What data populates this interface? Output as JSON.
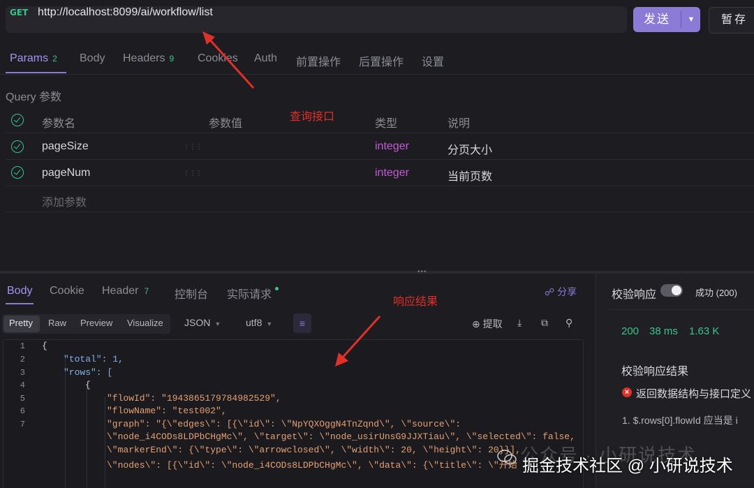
{
  "request": {
    "method": "GET",
    "url": "http://localhost:8099/ai/workflow/list",
    "send_label": "发送",
    "save_label": "暂存"
  },
  "request_tabs": [
    {
      "label": "Params",
      "count": "2"
    },
    {
      "label": "Body",
      "count": ""
    },
    {
      "label": "Headers",
      "count": "9"
    },
    {
      "label": "Cookies",
      "count": ""
    },
    {
      "label": "Auth",
      "count": ""
    },
    {
      "label": "前置操作",
      "count": ""
    },
    {
      "label": "后置操作",
      "count": ""
    },
    {
      "label": "设置",
      "count": ""
    }
  ],
  "query": {
    "section_label": "Query 参数",
    "columns": {
      "name": "参数名",
      "value": "参数值",
      "type": "类型",
      "desc": "说明"
    },
    "rows": [
      {
        "name": "pageSize",
        "value": "",
        "type": "integer",
        "desc": "分页大小"
      },
      {
        "name": "pageNum",
        "value": "",
        "type": "integer",
        "desc": "当前页数"
      }
    ],
    "add_placeholder": "添加参数"
  },
  "annotations": {
    "query_api": "查询接口",
    "response_result": "响应结果"
  },
  "response_tabs": [
    {
      "label": "Body",
      "count": ""
    },
    {
      "label": "Cookie",
      "count": ""
    },
    {
      "label": "Header",
      "count": "7"
    },
    {
      "label": "控制台",
      "count": ""
    },
    {
      "label": "实际请求",
      "count": ""
    }
  ],
  "share_label": "分享",
  "view_modes": [
    "Pretty",
    "Raw",
    "Preview",
    "Visualize"
  ],
  "format_select": "JSON",
  "encoding_select": "utf8",
  "toolbar": {
    "extract_label": "提取"
  },
  "code_lines": [
    {
      "num": "1",
      "text": "{"
    },
    {
      "num": "2",
      "text": "\"total\": 1,"
    },
    {
      "num": "3",
      "text": "\"rows\": ["
    },
    {
      "num": "4",
      "text": "{"
    },
    {
      "num": "5",
      "text": "\"flowId\": \"1943865179784982529\","
    },
    {
      "num": "6",
      "text": "\"flowName\": \"test002\","
    },
    {
      "num": "7",
      "text": "\"graph\": \"{\\\"edges\\\": [{\\\"id\\\": \\\"NpYQXOggN4TnZqnd\\\", \\\"source\\\":"
    }
  ],
  "code_wrapped": [
    "\\\"node_i4CODs8LDPbCHgMc\\\", \\\"target\\\": \\\"node_usirUnsG9JJXTiau\\\", \\\"selected\\\": false,",
    "\\\"markerEnd\\\": {\\\"type\\\": \\\"arrowclosed\\\", \\\"width\\\": 20, \\\"height\\\": 20}}],",
    "\\\"nodes\\\": [{\\\"id\\\": \\\"node_i4CODs8LDPbCHgMc\\\", \\\"data\\\": {\\\"title\\\": \\\"开始"
  ],
  "validation": {
    "label": "校验响应",
    "status": "成功 (200)",
    "http_code": "200",
    "time": "38 ms",
    "size": "1.63 K",
    "result_title": "校验响应结果",
    "error_text": "返回数据结构与接口定义",
    "rule_text": "1. $.rows[0].flowId 应当是 i"
  },
  "watermark": {
    "faint": "公众号 · 小研说技术",
    "main": "掘金技术社区 @ 小研说技术"
  }
}
